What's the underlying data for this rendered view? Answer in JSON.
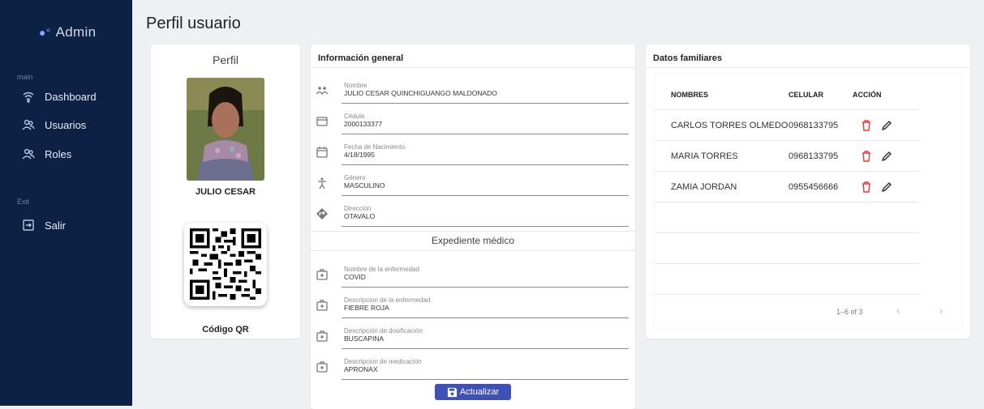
{
  "sidebar": {
    "brand": "Admin",
    "section_main": "main",
    "section_exit": "Exit",
    "items": [
      {
        "label": "Dashboard",
        "icon": "dashboard-icon"
      },
      {
        "label": "Usuarios",
        "icon": "users-icon"
      },
      {
        "label": "Roles",
        "icon": "roles-icon"
      }
    ],
    "exit_item": {
      "label": "Salir",
      "icon": "logout-icon"
    }
  },
  "page": {
    "title": "Perfil usuario"
  },
  "perfil": {
    "heading": "Perfil",
    "name": "JULIO CESAR",
    "qr_label": "Código QR"
  },
  "info": {
    "heading": "Información general",
    "fields": [
      {
        "label": "Nombre",
        "value": "JULIO CESAR QUINCHIGUANGO MALDONADO",
        "icon": "people-icon"
      },
      {
        "label": "Cédula",
        "value": "2000133377",
        "icon": "card-icon"
      },
      {
        "label": "Fecha de Nacimiento",
        "value": "4/18/1995",
        "icon": "calendar-icon"
      },
      {
        "label": "Género",
        "value": "MASCULINO",
        "icon": "person-icon"
      },
      {
        "label": "Dirección",
        "value": "OTAVALO",
        "icon": "direction-icon"
      }
    ],
    "expediente_heading": "Expediente médico",
    "medical": [
      {
        "label": "Nombre de la enfermedad",
        "value": "COVID",
        "icon": "medical-kit-icon"
      },
      {
        "label": "Descripcion de la enfermedad",
        "value": "FIEBRE ROJA",
        "icon": "medical-kit-icon"
      },
      {
        "label": "Descripción de dosificación",
        "value": "BUSCAPINA",
        "icon": "medical-kit-icon"
      },
      {
        "label": "Descripcion de medicación",
        "value": "APRONAX",
        "icon": "medical-kit-icon"
      }
    ],
    "button_label": "Actualizar"
  },
  "familia": {
    "heading": "Datos familiares",
    "columns": [
      "NOMBRES",
      "CELULAR",
      "ACCIÓN"
    ],
    "rows": [
      {
        "name": "CARLOS TORRES OLMEDO",
        "phone": "0968133795"
      },
      {
        "name": "MARIA TORRES",
        "phone": "0968133795"
      },
      {
        "name": "ZAMIA JORDAN",
        "phone": "0955456666"
      }
    ],
    "pagination": "1–6 of 3",
    "prev": "‹",
    "next": "›"
  },
  "colors": {
    "sidebar": "#0d2145",
    "accent": "#3f51b5",
    "delete": "#e53935"
  }
}
